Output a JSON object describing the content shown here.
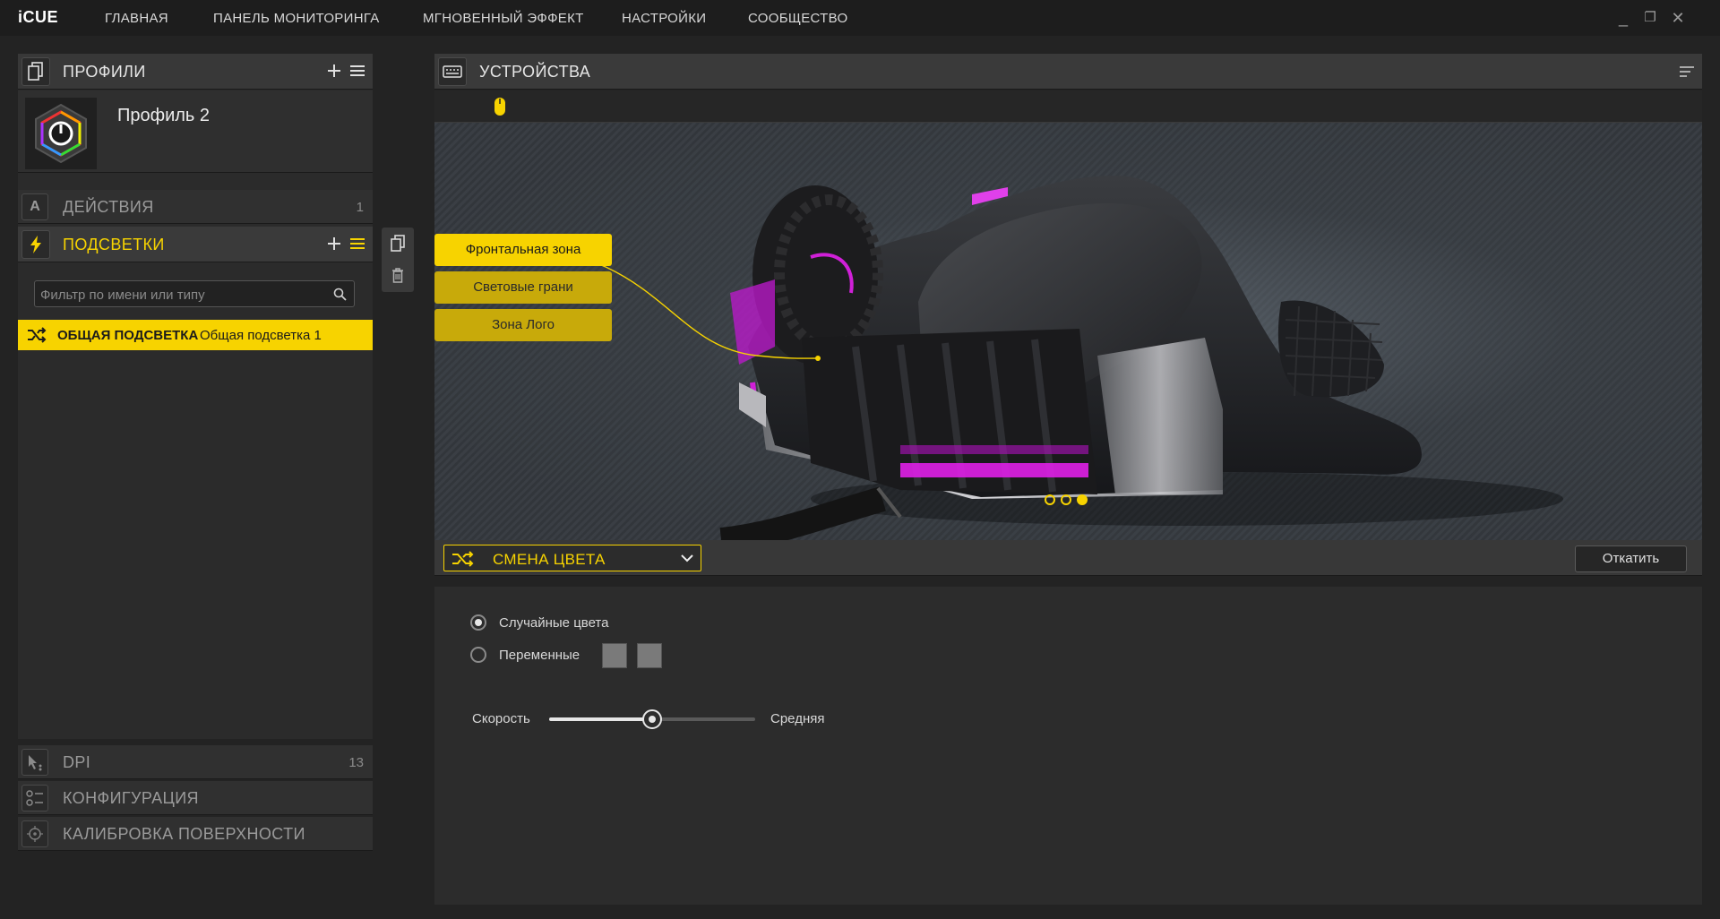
{
  "app": {
    "name": "iCUE"
  },
  "nav": [
    {
      "label": "ГЛАВНАЯ"
    },
    {
      "label": "ПАНЕЛЬ МОНИТОРИНГА"
    },
    {
      "label": "МГНОВЕННЫЙ ЭФФЕКТ"
    },
    {
      "label": "НАСТРОЙКИ"
    },
    {
      "label": "СООБЩЕСТВО"
    }
  ],
  "window_controls": {
    "minimize": "_",
    "restore": "❐",
    "close": "✕"
  },
  "profiles": {
    "title": "ПРОФИЛИ",
    "current": {
      "name": "Профиль 2"
    }
  },
  "sections": {
    "actions": {
      "label": "ДЕЙСТВИЯ",
      "count": "1"
    },
    "lighting": {
      "label": "ПОДСВЕТКИ"
    },
    "dpi": {
      "label": "DPI",
      "count": "13"
    },
    "configuration": {
      "label": "КОНФИГУРАЦИЯ"
    },
    "calibration": {
      "label": "КАЛИБРОВКА ПОВЕРХНОСТИ"
    }
  },
  "filter": {
    "placeholder": "Фильтр по имени или типу"
  },
  "effect_list": [
    {
      "type": "ОБЩАЯ ПОДСВЕТКА",
      "name": "Общая подсветка 1",
      "selected": true
    }
  ],
  "devices": {
    "title": "УСТРОЙСТВА"
  },
  "zones": [
    {
      "label": "Фронтальная зона",
      "active": true
    },
    {
      "label": "Световые грани",
      "active": false
    },
    {
      "label": "Зона Лого",
      "active": false
    }
  ],
  "pager": {
    "count": 3,
    "active_index": 2
  },
  "effect": {
    "selected": "СМЕНА ЦВЕТА",
    "revert_label": "Откатить"
  },
  "settings": {
    "random_label": "Случайные цвета",
    "alternating_label": "Переменные",
    "mode": "random",
    "speed_label": "Скорость",
    "speed_value_label": "Средняя",
    "speed_fraction": 0.5
  },
  "colors": {
    "accent": "#f7d300",
    "zone_inactive": "#c8aa0a",
    "led_glow": "#e020e8"
  }
}
